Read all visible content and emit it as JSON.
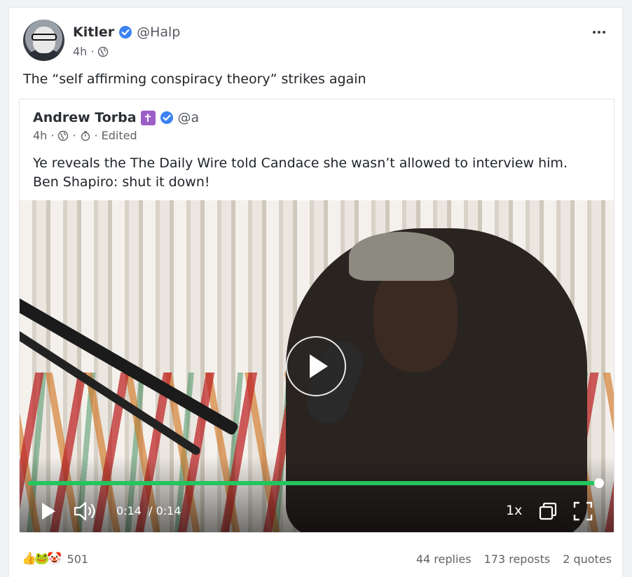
{
  "post": {
    "author": {
      "display_name": "Kitler",
      "handle": "@Halp",
      "time": "4h",
      "separator": "·"
    },
    "text": "The “self affirming conspiracy theory” strikes again",
    "quote": {
      "author": {
        "display_name": "Andrew Torba",
        "badge": "✝",
        "handle": "@a"
      },
      "meta": {
        "time": "4h",
        "sep1": "·",
        "sep2": "·",
        "sep3": "·",
        "edited": "Edited"
      },
      "text": "Ye reveals the The Daily Wire told Candace she wasn’t allowed to interview him. Ben Shapiro: shut it down!",
      "video": {
        "current_time": "0:14",
        "time_separator": "/",
        "duration": "0:14",
        "speed": "1x",
        "progress": 1.0,
        "accent_color": "#22c55e"
      }
    },
    "reactions": {
      "emojis": [
        "👍",
        "🐸",
        "🤡"
      ],
      "count": "501"
    },
    "stats": {
      "replies": "44 replies",
      "reposts": "173 reposts",
      "quotes": "2 quotes"
    }
  },
  "colors": {
    "verified": "#3b82f6",
    "badge": "#9b5fc8"
  }
}
